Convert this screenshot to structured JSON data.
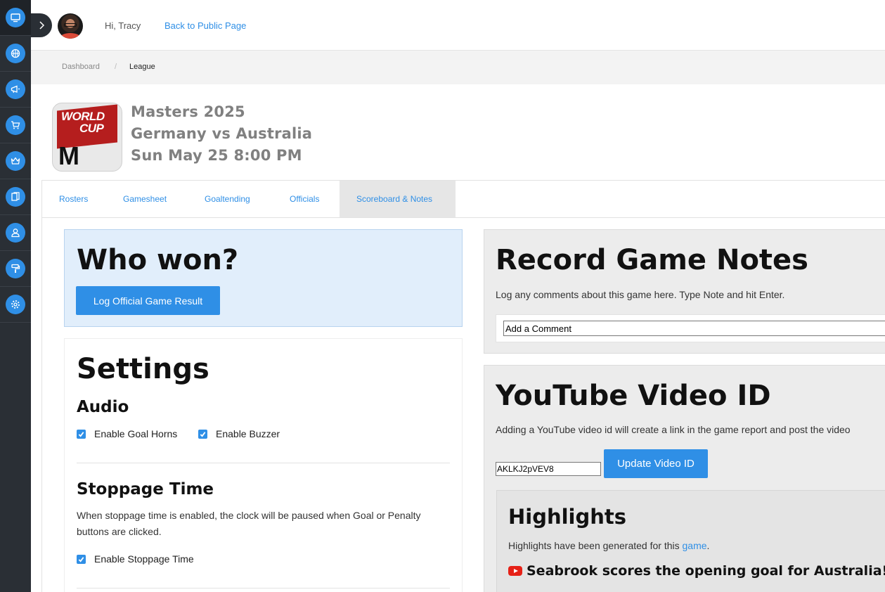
{
  "sidebar": {
    "items": [
      {
        "icon": "monitor-icon"
      },
      {
        "icon": "basketball-icon"
      },
      {
        "icon": "megaphone-icon"
      },
      {
        "icon": "shopping-cart-icon"
      },
      {
        "icon": "crown-icon"
      },
      {
        "icon": "documents-icon"
      },
      {
        "icon": "user-icon"
      },
      {
        "icon": "paint-roller-icon"
      },
      {
        "icon": "gear-icon"
      }
    ]
  },
  "header": {
    "greeting": "Hi, Tracy",
    "back_link": "Back to Public Page"
  },
  "breadcrumb": {
    "items": [
      "Dashboard",
      "League"
    ],
    "separator": "/"
  },
  "game": {
    "league": "Masters 2025",
    "matchup": "Germany vs Australia",
    "datetime": "Sun May 25 8:00 PM",
    "logo_text": {
      "line1": "WORLD",
      "line2": "CUP",
      "letter": "M"
    }
  },
  "tabs": [
    {
      "label": "Rosters",
      "active": false
    },
    {
      "label": "Gamesheet",
      "active": false
    },
    {
      "label": "Goaltending",
      "active": false
    },
    {
      "label": "Officials",
      "active": false
    },
    {
      "label": "Scoreboard & Notes",
      "active": true
    }
  ],
  "who_won": {
    "title": "Who won?",
    "button": "Log Official Game Result"
  },
  "settings": {
    "title": "Settings",
    "audio": {
      "title": "Audio",
      "options": [
        {
          "label": "Enable Goal Horns",
          "checked": true
        },
        {
          "label": "Enable Buzzer",
          "checked": true
        }
      ]
    },
    "stoppage": {
      "title": "Stoppage Time",
      "description": "When stoppage time is enabled, the clock will be paused when Goal or Penalty buttons are clicked.",
      "option": {
        "label": "Enable Stoppage Time",
        "checked": true
      }
    }
  },
  "notes": {
    "title": "Record Game Notes",
    "subtitle": "Log any comments about this game here. Type Note and hit Enter.",
    "input_value": "Add a Comment"
  },
  "youtube": {
    "title": "YouTube Video ID",
    "subtitle": "Adding a YouTube video id will create a link in the game report and post the video",
    "video_id": "AKLKJ2pVEV8",
    "button": "Update Video ID",
    "highlights": {
      "title": "Highlights",
      "text_before": "Highlights have been generated for this ",
      "link": "game",
      "text_after": ".",
      "video_title": "Seabrook scores the opening goal for Australia!"
    }
  },
  "colors": {
    "accent": "#2f8fe6",
    "sidebar": "#2a2f35",
    "who_won_bg": "#e1eefb",
    "youtube_red": "#e62117"
  }
}
